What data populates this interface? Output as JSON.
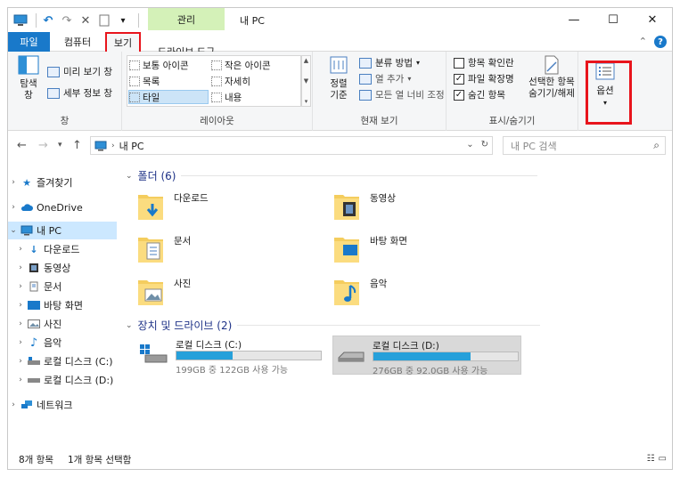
{
  "window": {
    "title": "내 PC",
    "context_tab": "관리",
    "controls": {
      "minimize": "—",
      "maximize": "☐",
      "close": "✕"
    }
  },
  "quick_access": {
    "undo": "↶",
    "redo": "↷",
    "delete": "✕",
    "dropdown": "▾"
  },
  "tabs": [
    {
      "label": "파일"
    },
    {
      "label": "컴퓨터"
    },
    {
      "label": "보기"
    },
    {
      "label": "드라이브 도구"
    }
  ],
  "ribbon": {
    "panes": {
      "nav_pane": "탐색\n창",
      "preview_pane": "미리 보기 창",
      "details_pane": "세부 정보 창",
      "label": "창"
    },
    "layout": {
      "items": [
        "보통 아이콘",
        "작은 아이콘",
        "목록",
        "자세히",
        "타일",
        "내용"
      ],
      "label": "레이아웃"
    },
    "current_view": {
      "sort_by": "정렬\n기준",
      "group_by": "분류 방법",
      "add_columns": "열 추가",
      "size_all_columns": "모든 열 너비 조정",
      "label": "현재 보기"
    },
    "show_hide": {
      "item_checkboxes": "항목 확인란",
      "file_extensions": "파일 확장명",
      "hidden_items": "숨긴 항목",
      "hide_selected": "선택한 항목\n숨기기/해제",
      "label": "표시/숨기기"
    },
    "options": {
      "label": "옵션"
    }
  },
  "address": {
    "path": "내 PC",
    "search_placeholder": "내 PC 검색"
  },
  "nav_pane": [
    {
      "label": "즐겨찾기",
      "level": 0,
      "icon": "star-icon"
    },
    {
      "label": "OneDrive",
      "level": 0,
      "icon": "cloud-icon"
    },
    {
      "label": "내 PC",
      "level": 0,
      "icon": "pc-icon",
      "selected": true
    },
    {
      "label": "다운로드",
      "level": 1,
      "icon": "download-icon"
    },
    {
      "label": "동영상",
      "level": 1,
      "icon": "video-icon"
    },
    {
      "label": "문서",
      "level": 1,
      "icon": "document-icon"
    },
    {
      "label": "바탕 화면",
      "level": 1,
      "icon": "desktop-icon"
    },
    {
      "label": "사진",
      "level": 1,
      "icon": "picture-icon"
    },
    {
      "label": "음악",
      "level": 1,
      "icon": "music-icon"
    },
    {
      "label": "로컬 디스크 (C:)",
      "level": 1,
      "icon": "disk-c-icon"
    },
    {
      "label": "로컬 디스크 (D:)",
      "level": 1,
      "icon": "disk-d-icon"
    },
    {
      "label": "네트워크",
      "level": 0,
      "icon": "network-icon"
    }
  ],
  "content": {
    "folders_header": "폴더 (6)",
    "folders": [
      {
        "name": "다운로드",
        "icon": "download-folder-icon"
      },
      {
        "name": "동영상",
        "icon": "video-folder-icon"
      },
      {
        "name": "문서",
        "icon": "document-folder-icon"
      },
      {
        "name": "바탕 화면",
        "icon": "desktop-folder-icon"
      },
      {
        "name": "사진",
        "icon": "picture-folder-icon"
      },
      {
        "name": "음악",
        "icon": "music-folder-icon"
      }
    ],
    "drives_header": "장치 및 드라이브 (2)",
    "drives": [
      {
        "name": "로컬 디스크 (C:)",
        "free": "199GB 중 122GB 사용 가능",
        "used_fraction": 0.39
      },
      {
        "name": "로컬 디스크 (D:)",
        "free": "276GB 중 92.0GB 사용 가능",
        "used_fraction": 0.67,
        "selected": true
      }
    ]
  },
  "status": {
    "item_count": "8개 항목",
    "selected_count": "1개 항목 선택함"
  },
  "colors": {
    "accent": "#1979ca",
    "highlight_red": "#e8141c",
    "context_green": "#d4f1b8",
    "drive_bar": "#26a0da"
  }
}
